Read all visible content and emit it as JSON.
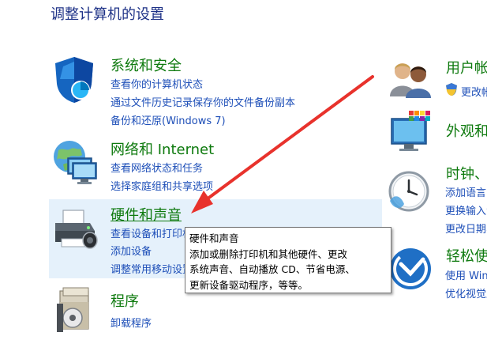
{
  "window": {
    "title": "调整计算机的设置"
  },
  "categories": {
    "system": {
      "title": "系统和安全",
      "links": [
        "查看你的计算机状态",
        "通过文件历史记录保存你的文件备份副本",
        "备份和还原(Windows 7)"
      ]
    },
    "network": {
      "title": "网络和 Internet",
      "links": [
        "查看网络状态和任务",
        "选择家庭组和共享选项"
      ]
    },
    "hardware": {
      "title": "硬件和声音",
      "links": [
        "查看设备和打印机",
        "添加设备",
        "调整常用移动设置"
      ]
    },
    "programs": {
      "title": "程序",
      "links": [
        "卸载程序"
      ]
    },
    "user": {
      "title": "用户帐户",
      "links": [
        "更改帐户类型"
      ]
    },
    "appearance": {
      "title": "外观和个性化"
    },
    "clock": {
      "title": "时钟、语言和区域",
      "links": [
        "添加语言",
        "更换输入法",
        "更改日期、时间或数字格式"
      ]
    },
    "ease": {
      "title": "轻松使用",
      "links": [
        "使用 Windows 建议的设置",
        "优化视觉显示"
      ]
    }
  },
  "tooltip": {
    "title": "硬件和声音",
    "lines": [
      "添加或删除打印机和其他硬件、更改",
      "系统声音、自动播放 CD、节省电源、",
      "更新设备驱动程序，等等。"
    ]
  },
  "colors": {
    "title": "#1e3287",
    "category": "#0e7a0e",
    "link": "#1e4fb8",
    "hover": "#e5f1fb",
    "arrow": "#e8322c"
  }
}
